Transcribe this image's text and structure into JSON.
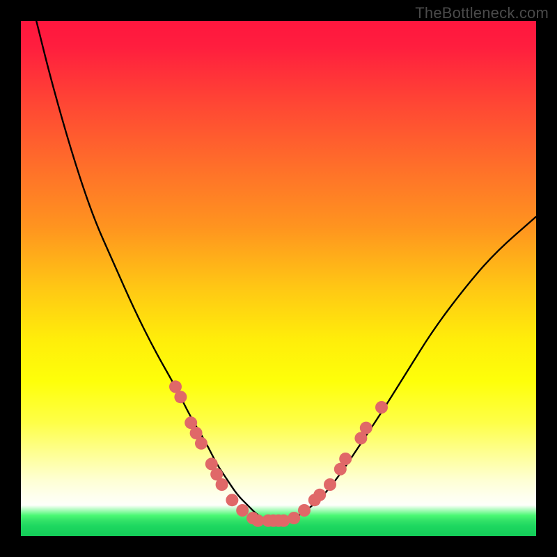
{
  "watermark": "TheBottleneck.com",
  "chart_data": {
    "type": "line",
    "title": "",
    "xlabel": "",
    "ylabel": "",
    "xlim": [
      0,
      100
    ],
    "ylim": [
      0,
      100
    ],
    "curve": {
      "name": "bottleneck-curve",
      "x": [
        3,
        6,
        10,
        14,
        18,
        22,
        26,
        30,
        33,
        36,
        38,
        40,
        42,
        44,
        46,
        48,
        50,
        52,
        54,
        58,
        62,
        66,
        70,
        75,
        80,
        86,
        92,
        100
      ],
      "y": [
        100,
        88,
        74,
        62,
        53,
        44,
        36,
        29,
        23,
        18,
        14,
        11,
        8,
        6,
        4,
        3,
        3,
        3,
        4,
        7,
        12,
        18,
        24,
        32,
        40,
        48,
        55,
        62
      ]
    },
    "dots": {
      "name": "sample-points",
      "color": "#e06868",
      "points": [
        {
          "x": 30,
          "y": 29
        },
        {
          "x": 31,
          "y": 27
        },
        {
          "x": 33,
          "y": 22
        },
        {
          "x": 34,
          "y": 20
        },
        {
          "x": 35,
          "y": 18
        },
        {
          "x": 37,
          "y": 14
        },
        {
          "x": 38,
          "y": 12
        },
        {
          "x": 39,
          "y": 10
        },
        {
          "x": 41,
          "y": 7
        },
        {
          "x": 43,
          "y": 5
        },
        {
          "x": 45,
          "y": 3.5
        },
        {
          "x": 46,
          "y": 3
        },
        {
          "x": 48,
          "y": 3
        },
        {
          "x": 49,
          "y": 3
        },
        {
          "x": 50,
          "y": 3
        },
        {
          "x": 51,
          "y": 3
        },
        {
          "x": 53,
          "y": 3.5
        },
        {
          "x": 55,
          "y": 5
        },
        {
          "x": 57,
          "y": 7
        },
        {
          "x": 58,
          "y": 8
        },
        {
          "x": 60,
          "y": 10
        },
        {
          "x": 62,
          "y": 13
        },
        {
          "x": 63,
          "y": 15
        },
        {
          "x": 66,
          "y": 19
        },
        {
          "x": 67,
          "y": 21
        },
        {
          "x": 70,
          "y": 25
        }
      ]
    }
  }
}
